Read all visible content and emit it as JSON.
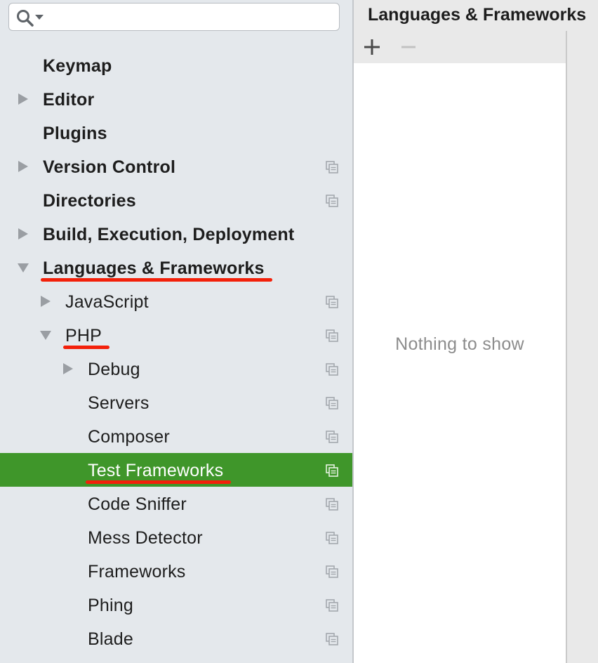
{
  "search": {
    "value": "",
    "placeholder": ""
  },
  "tree": [
    {
      "label": "Keymap",
      "bold": true,
      "level": 0,
      "expander": "none",
      "copyable": false,
      "selected": false,
      "underlined": false
    },
    {
      "label": "Editor",
      "bold": true,
      "level": 0,
      "expander": "collapsed",
      "copyable": false,
      "selected": false,
      "underlined": false
    },
    {
      "label": "Plugins",
      "bold": true,
      "level": 0,
      "expander": "none",
      "copyable": false,
      "selected": false,
      "underlined": false
    },
    {
      "label": "Version Control",
      "bold": true,
      "level": 0,
      "expander": "collapsed",
      "copyable": true,
      "selected": false,
      "underlined": false
    },
    {
      "label": "Directories",
      "bold": true,
      "level": 0,
      "expander": "none",
      "copyable": true,
      "selected": false,
      "underlined": false
    },
    {
      "label": "Build, Execution, Deployment",
      "bold": true,
      "level": 0,
      "expander": "collapsed",
      "copyable": false,
      "selected": false,
      "underlined": false
    },
    {
      "label": "Languages & Frameworks",
      "bold": true,
      "level": 0,
      "expander": "expanded",
      "copyable": false,
      "selected": false,
      "underlined": true
    },
    {
      "label": "JavaScript",
      "bold": false,
      "level": 1,
      "expander": "collapsed",
      "copyable": true,
      "selected": false,
      "underlined": false
    },
    {
      "label": "PHP",
      "bold": false,
      "level": 1,
      "expander": "expanded",
      "copyable": true,
      "selected": false,
      "underlined": true
    },
    {
      "label": "Debug",
      "bold": false,
      "level": 2,
      "expander": "collapsed",
      "copyable": true,
      "selected": false,
      "underlined": false
    },
    {
      "label": "Servers",
      "bold": false,
      "level": 2,
      "expander": "none",
      "copyable": true,
      "selected": false,
      "underlined": false
    },
    {
      "label": "Composer",
      "bold": false,
      "level": 2,
      "expander": "none",
      "copyable": true,
      "selected": false,
      "underlined": false
    },
    {
      "label": "Test Frameworks",
      "bold": false,
      "level": 2,
      "expander": "none",
      "copyable": true,
      "selected": true,
      "underlined": true
    },
    {
      "label": "Code Sniffer",
      "bold": false,
      "level": 2,
      "expander": "none",
      "copyable": true,
      "selected": false,
      "underlined": false
    },
    {
      "label": "Mess Detector",
      "bold": false,
      "level": 2,
      "expander": "none",
      "copyable": true,
      "selected": false,
      "underlined": false
    },
    {
      "label": "Frameworks",
      "bold": false,
      "level": 2,
      "expander": "none",
      "copyable": true,
      "selected": false,
      "underlined": false
    },
    {
      "label": "Phing",
      "bold": false,
      "level": 2,
      "expander": "none",
      "copyable": true,
      "selected": false,
      "underlined": false
    },
    {
      "label": "Blade",
      "bold": false,
      "level": 2,
      "expander": "none",
      "copyable": true,
      "selected": false,
      "underlined": false
    }
  ],
  "content": {
    "title": "Languages & Frameworks",
    "empty_text": "Nothing to show",
    "toolbar": {
      "add_icon": "plus-icon",
      "remove_icon": "minus-icon",
      "remove_enabled": false
    }
  },
  "colors": {
    "selection": "#3f962a",
    "annotation_underline": "#f3200a",
    "sidebar_bg": "#e4e8ec",
    "list_bg": "#ffffff"
  },
  "icons": {
    "search": "search-icon",
    "row_action": "copy-icon",
    "collapsed": "triangle-right-icon",
    "expanded": "triangle-down-icon"
  }
}
